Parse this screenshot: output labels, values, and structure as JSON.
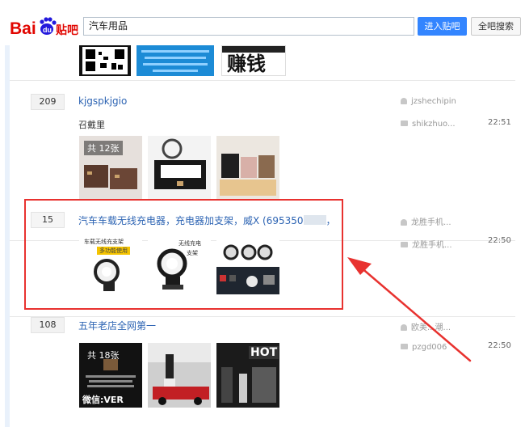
{
  "header": {
    "logo_text": "Bai du 贴吧",
    "search_value": "汽车用品",
    "enter_button": "进入贴吧",
    "all_search_button": "全吧搜索"
  },
  "top_post": {
    "thumb_3_text": "赚钱"
  },
  "posts": [
    {
      "reply_count": "209",
      "title": "kjgspkjgio",
      "excerpt": "召戴里",
      "author": "jzshechipin",
      "last_reply_user": "shikzhuo...",
      "last_reply_time": "22:51",
      "thumb_badge": "共 12张"
    },
    {
      "reply_count": "15",
      "title": "汽车车载无线充电器，充电器加支架，威X (695350",
      "title_suffix": "，",
      "author": "龙胜手机...",
      "last_reply_user": "龙胜手机...",
      "last_reply_time": "22:50",
      "thumb_1_caption": "车载无线充支架",
      "thumb_1_sub": "多功能使用",
      "thumb_2_caption": "无线充电",
      "thumb_2_sub": "支架"
    },
    {
      "reply_count": "108",
      "title": "五年老店全网第一",
      "author": "欧美...潮...",
      "last_reply_user": "pzgd006",
      "last_reply_time": "22:50",
      "thumb_badge": "共 18张",
      "thumb_1_text": "微信:VER",
      "thumb_3_text": "HOT"
    }
  ],
  "colors": {
    "accent_blue": "#3385ff",
    "link_blue": "#2d64b3",
    "highlight_red": "#e8322f",
    "logo_red": "#e10601",
    "logo_blue": "#2319dc"
  },
  "icons": [
    "user-icon",
    "reply-icon",
    "baidu-paw-icon",
    "red-arrow-annotation"
  ]
}
